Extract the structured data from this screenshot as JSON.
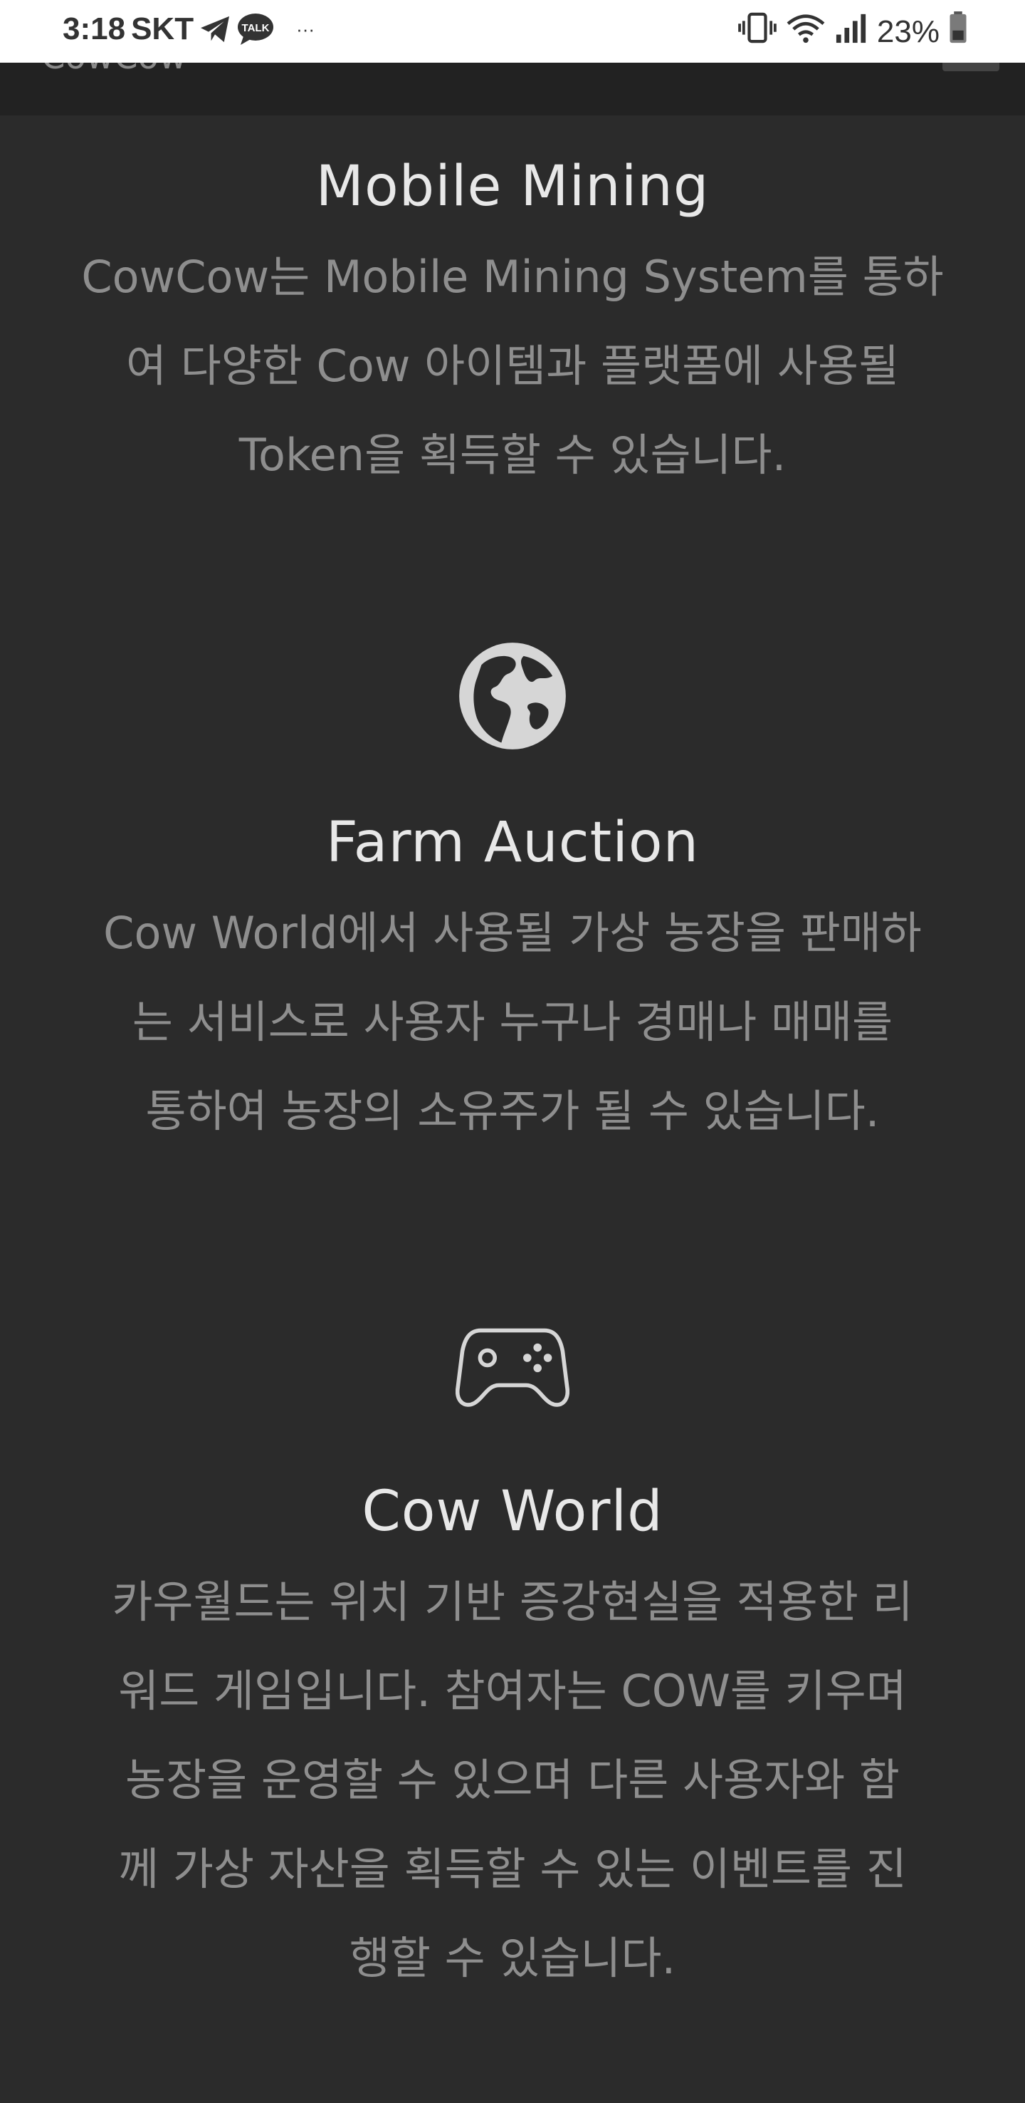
{
  "status_bar": {
    "time": "3:18",
    "carrier": "SKT",
    "talk_badge": "TALK",
    "more": "···",
    "battery": "23%"
  },
  "nav": {
    "brand": "CowCow"
  },
  "features": [
    {
      "icon": "mining-icon",
      "title": "Mobile Mining",
      "text": "CowCow는 Mobile Mining System를 통하\n여 다양한 Cow 아이템과 플랫폼에 사용될\nToken을 획득할 수 있습니다."
    },
    {
      "icon": "globe-icon",
      "title": "Farm Auction",
      "text": "Cow World에서 사용될 가상 농장을 판매하\n는 서비스로 사용자 누구나 경매나 매매를\n통하여 농장의 소유주가 될 수 있습니다."
    },
    {
      "icon": "gamepad-icon",
      "title": "Cow World",
      "text": "카우월드는 위치 기반 증강현실을 적용한 리\n워드 게임입니다. 참여자는 COW를 키우며\n농장을 운영할 수 있으며 다른 사용자와 함\n께 가상 자산을 획득할 수 있는 이벤트를 진\n행할 수 있습니다."
    }
  ],
  "colors": {
    "background": "#2b2b2b",
    "nav_background": "#222222",
    "title": "#e8e8e8",
    "body_text": "#8e8e8e",
    "icon": "#d6d6d6"
  }
}
